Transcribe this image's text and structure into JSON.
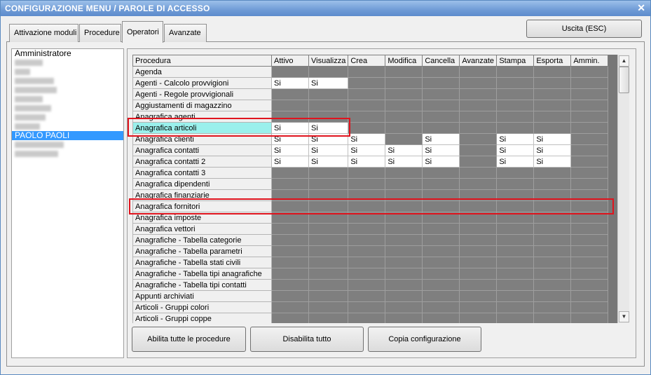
{
  "window": {
    "title": "CONFIGURAZIONE MENU / PAROLE DI ACCESSO",
    "close_glyph": "✕"
  },
  "tabs": [
    {
      "label": "Attivazione moduli",
      "active": false
    },
    {
      "label": "Procedure",
      "active": false
    },
    {
      "label": "Operatori",
      "active": true
    },
    {
      "label": "Avanzate",
      "active": false
    }
  ],
  "exit_button": "Uscita (ESC)",
  "users": [
    {
      "label": "Amministratore",
      "blurred": false,
      "selected": false
    },
    {
      "label": "",
      "blurred": true,
      "selected": false
    },
    {
      "label": "",
      "blurred": true,
      "selected": false
    },
    {
      "label": "",
      "blurred": true,
      "selected": false
    },
    {
      "label": "",
      "blurred": true,
      "selected": false
    },
    {
      "label": "",
      "blurred": true,
      "selected": false
    },
    {
      "label": "",
      "blurred": true,
      "selected": false
    },
    {
      "label": "",
      "blurred": true,
      "selected": false
    },
    {
      "label": "",
      "blurred": true,
      "selected": false
    },
    {
      "label": "PAOLO PAOLI",
      "blurred": false,
      "selected": true
    },
    {
      "label": "",
      "blurred": true,
      "selected": false
    },
    {
      "label": "",
      "blurred": true,
      "selected": false
    }
  ],
  "grid": {
    "columns": [
      "Procedura",
      "Attivo",
      "Visualizza",
      "Crea",
      "Modifica",
      "Cancella",
      "Avanzate",
      "Stampa",
      "Esporta",
      "Ammin."
    ],
    "rows": [
      {
        "procedura": "Agenda",
        "cells": [
          "",
          "",
          "",
          "",
          "",
          "",
          "",
          "",
          ""
        ]
      },
      {
        "procedura": "Agenti - Calcolo provvigioni",
        "cells": [
          "Si",
          "Si",
          "",
          "",
          "",
          "",
          "",
          "",
          ""
        ]
      },
      {
        "procedura": "Agenti - Regole provvigionali",
        "cells": [
          "",
          "",
          "",
          "",
          "",
          "",
          "",
          "",
          ""
        ]
      },
      {
        "procedura": "Aggiustamenti di magazzino",
        "cells": [
          "",
          "",
          "",
          "",
          "",
          "",
          "",
          "",
          ""
        ]
      },
      {
        "procedura": "Anagrafica agenti",
        "cells": [
          "",
          "",
          "",
          "",
          "",
          "",
          "",
          "",
          ""
        ]
      },
      {
        "procedura": "Anagrafica articoli",
        "cells": [
          "Si",
          "Si",
          "",
          "",
          "",
          "",
          "",
          "",
          ""
        ],
        "highlight": true
      },
      {
        "procedura": "Anagrafica clienti",
        "cells": [
          "Si",
          "Si",
          "Si",
          "",
          "Si",
          "",
          "Si",
          "Si",
          ""
        ]
      },
      {
        "procedura": "Anagrafica contatti",
        "cells": [
          "Si",
          "Si",
          "Si",
          "Si",
          "Si",
          "",
          "Si",
          "Si",
          ""
        ]
      },
      {
        "procedura": "Anagrafica contatti 2",
        "cells": [
          "Si",
          "Si",
          "Si",
          "Si",
          "Si",
          "",
          "Si",
          "Si",
          ""
        ]
      },
      {
        "procedura": "Anagrafica contatti 3",
        "cells": [
          "",
          "",
          "",
          "",
          "",
          "",
          "",
          "",
          ""
        ]
      },
      {
        "procedura": "Anagrafica dipendenti",
        "cells": [
          "",
          "",
          "",
          "",
          "",
          "",
          "",
          "",
          ""
        ]
      },
      {
        "procedura": "Anagrafica finanziarie",
        "cells": [
          "",
          "",
          "",
          "",
          "",
          "",
          "",
          "",
          ""
        ]
      },
      {
        "procedura": "Anagrafica fornitori",
        "cells": [
          "",
          "",
          "",
          "",
          "",
          "",
          "",
          "",
          ""
        ]
      },
      {
        "procedura": "Anagrafica imposte",
        "cells": [
          "",
          "",
          "",
          "",
          "",
          "",
          "",
          "",
          ""
        ]
      },
      {
        "procedura": "Anagrafica vettori",
        "cells": [
          "",
          "",
          "",
          "",
          "",
          "",
          "",
          "",
          ""
        ]
      },
      {
        "procedura": "Anagrafiche - Tabella categorie",
        "cells": [
          "",
          "",
          "",
          "",
          "",
          "",
          "",
          "",
          ""
        ]
      },
      {
        "procedura": "Anagrafiche - Tabella parametri",
        "cells": [
          "",
          "",
          "",
          "",
          "",
          "",
          "",
          "",
          ""
        ]
      },
      {
        "procedura": "Anagrafiche - Tabella stati civili",
        "cells": [
          "",
          "",
          "",
          "",
          "",
          "",
          "",
          "",
          ""
        ]
      },
      {
        "procedura": "Anagrafiche - Tabella tipi anagrafiche",
        "cells": [
          "",
          "",
          "",
          "",
          "",
          "",
          "",
          "",
          ""
        ]
      },
      {
        "procedura": "Anagrafiche - Tabella tipi contatti",
        "cells": [
          "",
          "",
          "",
          "",
          "",
          "",
          "",
          "",
          ""
        ]
      },
      {
        "procedura": "Appunti archiviati",
        "cells": [
          "",
          "",
          "",
          "",
          "",
          "",
          "",
          "",
          ""
        ]
      },
      {
        "procedura": "Articoli - Gruppi colori",
        "cells": [
          "",
          "",
          "",
          "",
          "",
          "",
          "",
          "",
          ""
        ]
      },
      {
        "procedura": "Articoli - Gruppi coppe",
        "cells": [
          "",
          "",
          "",
          "",
          "",
          "",
          "",
          "",
          ""
        ]
      }
    ]
  },
  "scrollbar": {
    "up_glyph": "▲",
    "down_glyph": "▼"
  },
  "buttons": {
    "enable_all": "Abilita tutte le procedure",
    "disable_all": "Disabilita tutto",
    "copy_config": "Copia configurazione"
  },
  "colors": {
    "highlight_red": "#e0141e",
    "selection_blue": "#3399ff",
    "disabled_cell": "#7f7f7f",
    "highlight_row": "#9af0ec"
  }
}
